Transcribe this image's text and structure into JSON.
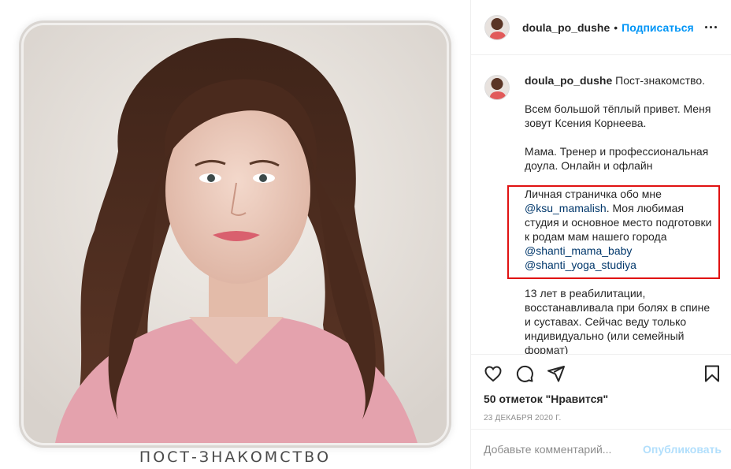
{
  "media": {
    "overlay_caption": "ПОСТ-ЗНАКОМСТВО"
  },
  "header": {
    "username": "doula_po_dushe",
    "separator": "•",
    "follow_label": "Подписаться",
    "more_icon": "more-horizontal-icon"
  },
  "caption": {
    "username": "doula_po_dushe",
    "first_line": "Пост-знакомство.",
    "paragraphs": [
      "Всем большой тёплый привет. Меня зовут Ксения Корнеева.",
      "Мама. Тренер и профессиональная доула. Онлайн и офлайн"
    ],
    "highlight": {
      "intro": "Личная страничка обо мне",
      "mention1": "@ksu_mamalish",
      "after_mention1": ". Моя любимая студия и основное место подготовки к родам мам нашего города",
      "mention2": "@shanti_mama_baby",
      "mention3": "@shanti_yoga_studiya"
    },
    "last_paragraph": "13 лет в реабилитации, восстанавливала при болях в спине и суставах. Сейчас веду только индивидуально (или семейный формат)",
    "highlight_color": "#e01212"
  },
  "actions": {
    "icons": [
      "heart-icon",
      "comment-icon",
      "share-icon",
      "bookmark-icon"
    ],
    "likes_text": "50 отметок \"Нравится\"",
    "date": "23 декабря 2020 г."
  },
  "comment_box": {
    "placeholder": "Добавьте комментарий...",
    "publish_label": "Опубликовать",
    "publish_color": "#b2dffc"
  },
  "colors": {
    "link_blue": "#0095f6",
    "mention": "#00376b",
    "text": "#262626",
    "muted": "#8e8e8e"
  }
}
